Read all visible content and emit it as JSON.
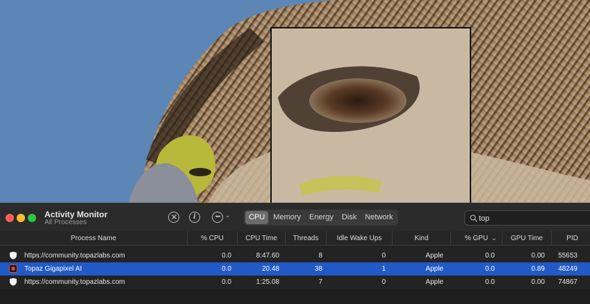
{
  "window": {
    "title": "Activity Monitor",
    "subtitle": "All Processes"
  },
  "toolbar": {
    "stop_icon": "stop-process-icon",
    "info_icon": "info-icon",
    "more_icon": "ellipsis-icon",
    "info_glyph": "i",
    "more_glyph": "•••",
    "chevron_glyph": "⌄"
  },
  "tabs": [
    {
      "label": "CPU",
      "active": true
    },
    {
      "label": "Memory",
      "active": false
    },
    {
      "label": "Energy",
      "active": false
    },
    {
      "label": "Disk",
      "active": false
    },
    {
      "label": "Network",
      "active": false
    }
  ],
  "search": {
    "value": "top",
    "placeholder": "Search"
  },
  "columns": [
    "Process Name",
    "% CPU",
    "CPU Time",
    "Threads",
    "Idle Wake Ups",
    "Kind",
    "% GPU",
    "GPU Time",
    "PID"
  ],
  "sort_indicator": "⌄",
  "rows": [
    {
      "name": "https://community.topazlabs.com",
      "cpu": "0.0",
      "cpu_time": "8:47.60",
      "threads": "8",
      "idle_wake_ups": "0",
      "kind": "Apple",
      "gpu": "0.0",
      "gpu_time": "0.00",
      "pid": "55653",
      "selected": false,
      "icon": "shield-icon"
    },
    {
      "name": "Topaz Gigapixel AI",
      "cpu": "0.0",
      "cpu_time": "20.48",
      "threads": "38",
      "idle_wake_ups": "1",
      "kind": "Apple",
      "gpu": "0.0",
      "gpu_time": "0.89",
      "pid": "48249",
      "selected": true,
      "icon": "gigapixel-app-icon"
    },
    {
      "name": "https://community.topazlabs.com",
      "cpu": "0.0",
      "cpu_time": "1:25.08",
      "threads": "7",
      "idle_wake_ups": "0",
      "kind": "Apple",
      "gpu": "0.0",
      "gpu_time": "0.00",
      "pid": "74867",
      "selected": false,
      "icon": "shield-icon"
    }
  ],
  "colors": {
    "selection": "#2159c7",
    "close": "#ff5f57",
    "minimize": "#febc2e",
    "maximize": "#28c840",
    "sky": "#5b86b6"
  }
}
